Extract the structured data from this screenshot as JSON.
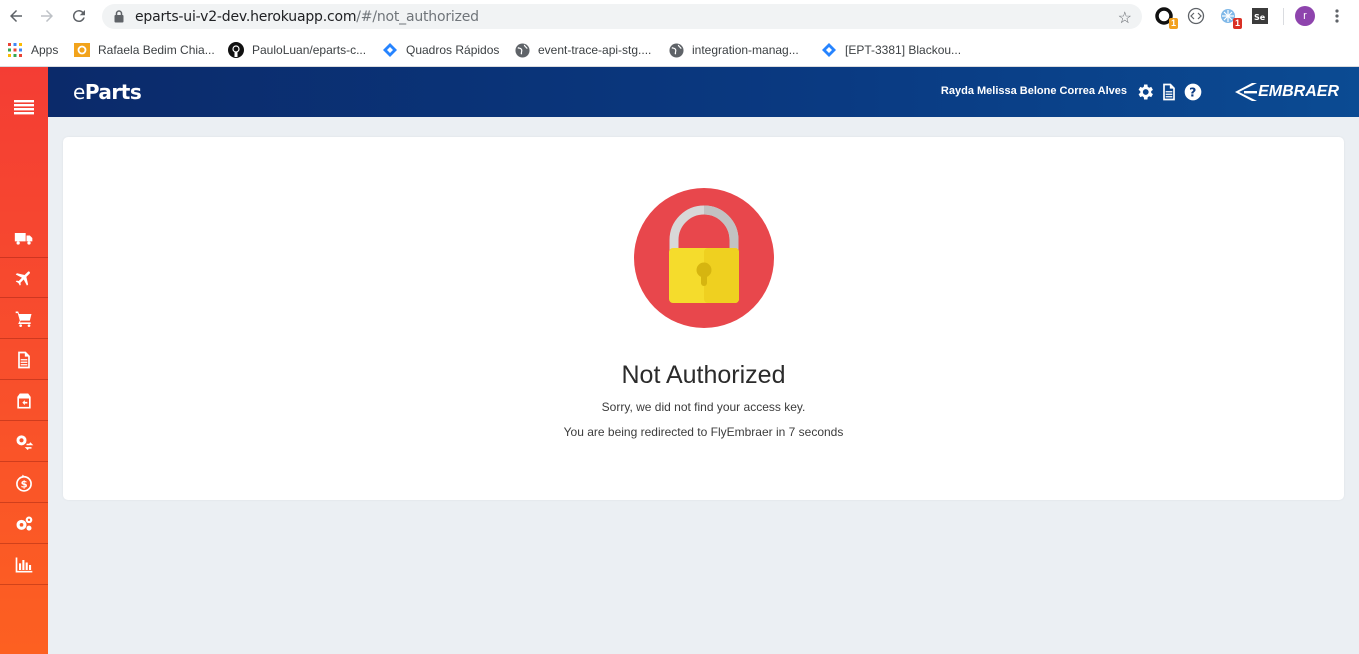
{
  "browser": {
    "url_host": "eparts-ui-v2-dev.herokuapp.com",
    "url_path": "/#/not_authorized",
    "extension_badges": [
      "1",
      "1"
    ],
    "profile_initial": "r",
    "bookmarks": [
      {
        "label": "Apps",
        "icon": "apps-grid-icon"
      },
      {
        "label": "Rafaela Bedim Chia...",
        "icon": "outlook-icon"
      },
      {
        "label": "PauloLuan/eparts-c...",
        "icon": "github-icon"
      },
      {
        "label": "Quadros Rápidos",
        "icon": "jira-icon"
      },
      {
        "label": "event-trace-api-stg....",
        "icon": "globe-icon"
      },
      {
        "label": "integration-manag...",
        "icon": "globe-icon"
      },
      {
        "label": "[EPT-3381] Blackou...",
        "icon": "jira-icon"
      }
    ]
  },
  "app": {
    "brand_e": "e",
    "brand_rest": "Parts",
    "user_name": "Rayda Melissa Belone Correa Alves",
    "logo_text": "EMBRAER",
    "sidebar_icons": [
      "truck-icon",
      "plane-icon",
      "cart-icon",
      "document-icon",
      "package-return-icon",
      "gear-exchange-icon",
      "dollar-refresh-icon",
      "gears-icon",
      "bar-chart-icon"
    ]
  },
  "main": {
    "title": "Not Authorized",
    "message": "Sorry, we did not find your access key.",
    "redirect": "You are being redirected to FlyEmbraer in 7 seconds"
  },
  "colors": {
    "sidebar": "#f84e2c",
    "topbar": "#0a3a82",
    "lock_circle": "#e8474c",
    "lock_body": "#f5dc2c"
  }
}
